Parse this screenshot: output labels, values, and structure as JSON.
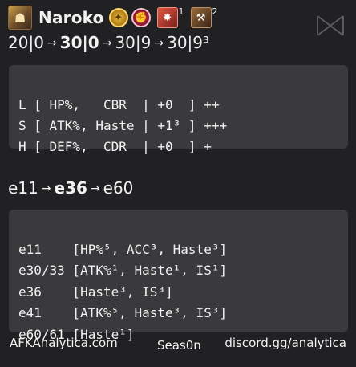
{
  "hero": {
    "name": "Naroko",
    "portrait_icon": "hero-portrait-icon",
    "faction_icon": "lightbearer-faction-icon",
    "class_icon": "support-class-icon",
    "signature_items": [
      {
        "icon": "signature-item-1-icon",
        "level": "1"
      },
      {
        "icon": "signature-item-2-icon",
        "level": "2"
      }
    ]
  },
  "si_progression": {
    "steps": [
      "20|0",
      "30|0",
      "30|9",
      "30|9³"
    ],
    "current_index": 1
  },
  "stat_priorities": {
    "lines": [
      "L [ HP%,   CBR  | +0  ] ++",
      "S [ ATK%, Haste | +1³ ] +++",
      "H [ DEF%,  CDR  | +0  ] +"
    ]
  },
  "furniture_progression": {
    "steps": [
      "e11",
      "e36",
      "e60"
    ],
    "current_index": 1
  },
  "furniture_recommendations": {
    "lines": [
      "e11    [HP%⁵, ACC³, Haste³]",
      "e30/33 [ATK%¹, Haste¹, IS¹]",
      "e36    [Haste³, IS³]",
      "e41    [ATK%⁵, Haste³, IS³]",
      "e60/61 [Haste¹]"
    ]
  },
  "footer": {
    "site": "AFKAnalytica.com",
    "season": "Seas0n",
    "discord": "discord.gg/analytica"
  },
  "colors": {
    "background": "#212123",
    "box": "#3a3a3c",
    "text": "#f2f2f2"
  }
}
